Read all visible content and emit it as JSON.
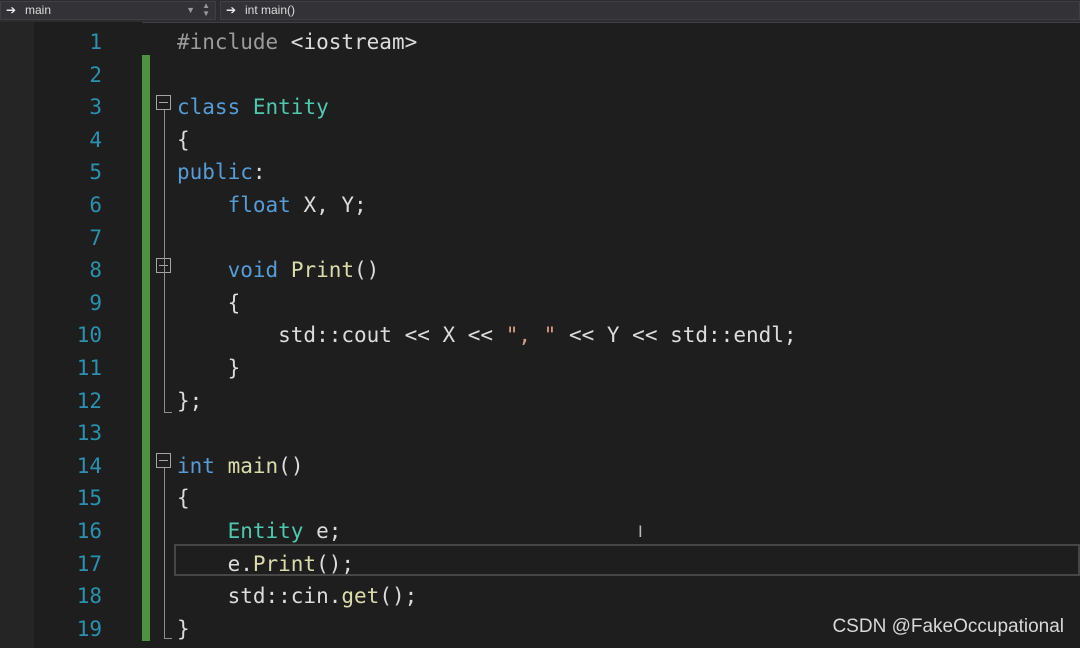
{
  "nav": {
    "scope": {
      "label": "main",
      "arrow": "➔"
    },
    "member": {
      "label": "int main()",
      "arrow": "➔"
    }
  },
  "editor": {
    "lines": [
      {
        "n": "1",
        "code": "#include <iostream>"
      },
      {
        "n": "2",
        "code": ""
      },
      {
        "n": "3",
        "code": "class Entity"
      },
      {
        "n": "4",
        "code": "{"
      },
      {
        "n": "5",
        "code": "public:"
      },
      {
        "n": "6",
        "code": "    float X, Y;"
      },
      {
        "n": "7",
        "code": ""
      },
      {
        "n": "8",
        "code": "    void Print()"
      },
      {
        "n": "9",
        "code": "    {"
      },
      {
        "n": "10",
        "code": "        std::cout << X << \", \" << Y << std::endl;"
      },
      {
        "n": "11",
        "code": "    }"
      },
      {
        "n": "12",
        "code": "};"
      },
      {
        "n": "13",
        "code": ""
      },
      {
        "n": "14",
        "code": "int main()"
      },
      {
        "n": "15",
        "code": "{"
      },
      {
        "n": "16",
        "code": "    Entity e;"
      },
      {
        "n": "17",
        "code": "    e.Print();"
      },
      {
        "n": "18",
        "code": "    std::cin.get();"
      },
      {
        "n": "19",
        "code": "}"
      }
    ]
  },
  "colors": {
    "keyword": "#569cd6",
    "type": "#4ec9b0",
    "function": "#dcdcaa",
    "string": "#d69d85",
    "line_number": "#2b91af",
    "change_bar": "#57a64a"
  },
  "icons": {
    "fold": "collapse-minus-icon",
    "nav": "arrow-right-icon",
    "cursor": "i-beam-cursor-icon"
  },
  "watermark": "CSDN @FakeOccupational"
}
